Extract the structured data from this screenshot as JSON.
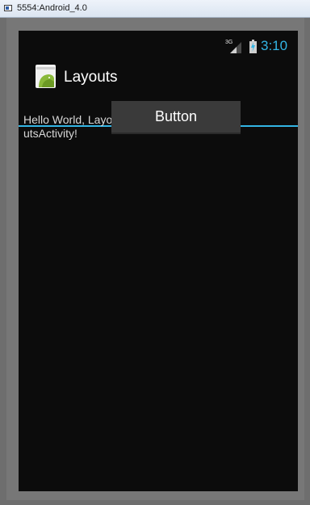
{
  "window": {
    "title": "5554:Android_4.0"
  },
  "status_bar": {
    "network_type": "3G",
    "signal_icon": "signal-icon",
    "battery_icon": "battery-charging-icon",
    "time": "3:10"
  },
  "action_bar": {
    "app_icon": "android-app-icon",
    "title": "Layouts"
  },
  "content": {
    "hello_text": "Hello World, LayoutsActivity!",
    "button_label": "Button"
  },
  "colors": {
    "accent_holo_blue": "#33b5e5",
    "screen_background": "#0c0c0c",
    "button_background": "#3a3a3a",
    "emulator_frame": "#777777"
  }
}
